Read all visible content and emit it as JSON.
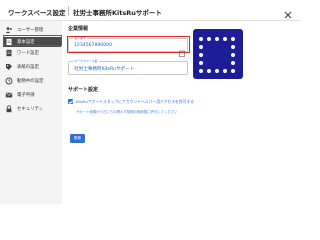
{
  "header": {
    "title": "ワークスペース設定",
    "workspace_name": "社労士事務所KitsRuサポート"
  },
  "sidebar": {
    "items": [
      {
        "label": "ユーザー管理",
        "icon": "users-icon"
      },
      {
        "label": "基本設定",
        "icon": "document-icon",
        "active": true
      },
      {
        "label": "ワード設定",
        "icon": "file-icon"
      },
      {
        "label": "表紙の設定",
        "icon": "tag-icon"
      },
      {
        "label": "勤務中の設定",
        "icon": "clock-icon"
      },
      {
        "label": "電子申請",
        "icon": "mail-icon"
      },
      {
        "label": "セキュリティ",
        "icon": "lock-icon"
      }
    ]
  },
  "main": {
    "company_section_title": "企業情報",
    "fields": {
      "corporate_number": {
        "label": "法人番号",
        "value": "1234567890000"
      },
      "display_name": {
        "label": "ワークスペース名",
        "value": "社労士事務所KitsRuサポート"
      }
    },
    "support_section_title": "サポート設定",
    "support_checkbox": {
      "label": "KitsRuサポートスタッフにアカウントヘルパー用アクセスを許可する",
      "checked": true
    },
    "support_note": "サポート依頼から日にちの問わず時間の無制限に許可してください",
    "save_label": "更新"
  },
  "colors": {
    "accent": "#2f6fd6",
    "highlight": "#e02828",
    "logo_bg": "#1d1d97",
    "sidebar_active": "#4a4a4a"
  }
}
